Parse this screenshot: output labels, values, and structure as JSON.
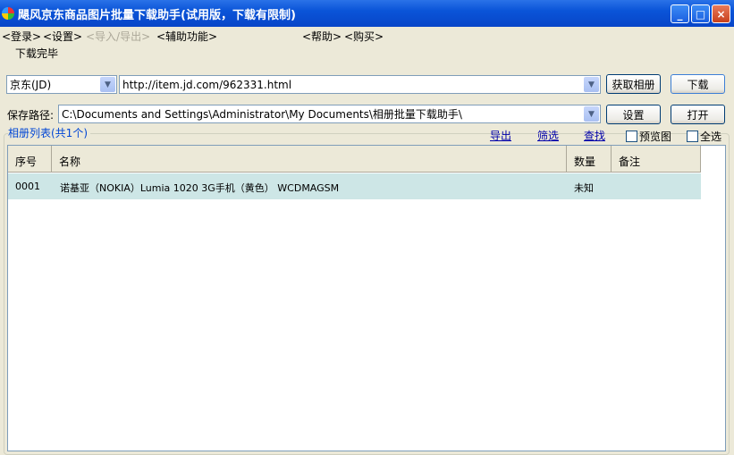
{
  "window": {
    "title": "飓风京东商品图片批量下载助手(试用版，下载有限制)",
    "minimize": "_",
    "maximize": "□",
    "close": "×"
  },
  "menu": [
    "<登录>",
    "<设置>",
    "<导入/导出>",
    "<辅助功能>",
    "<帮助>",
    "<购买>"
  ],
  "status": "下载完毕",
  "site_select": "京东(JD)",
  "url_input": "http://item.jd.com/962331.html",
  "buttons": {
    "fetch": "获取相册",
    "download": "下载",
    "settings": "设置",
    "open": "打开"
  },
  "save_path_label": "保存路径:",
  "save_path": "C:\\Documents and Settings\\Administrator\\My Documents\\相册批量下载助手\\",
  "list_title": "相册列表(共1个)",
  "links": {
    "export": "导出",
    "filter": "筛选",
    "find": "查找"
  },
  "checkboxes": {
    "preview": "预览图",
    "select_all": "全选"
  },
  "columns": [
    "序号",
    "名称",
    "数量",
    "备注"
  ],
  "rows": [
    {
      "no": "0001",
      "name": "诺基亚（NOKIA）Lumia 1020 3G手机（黄色） WCDMAGSM",
      "count": "未知",
      "note": ""
    }
  ]
}
